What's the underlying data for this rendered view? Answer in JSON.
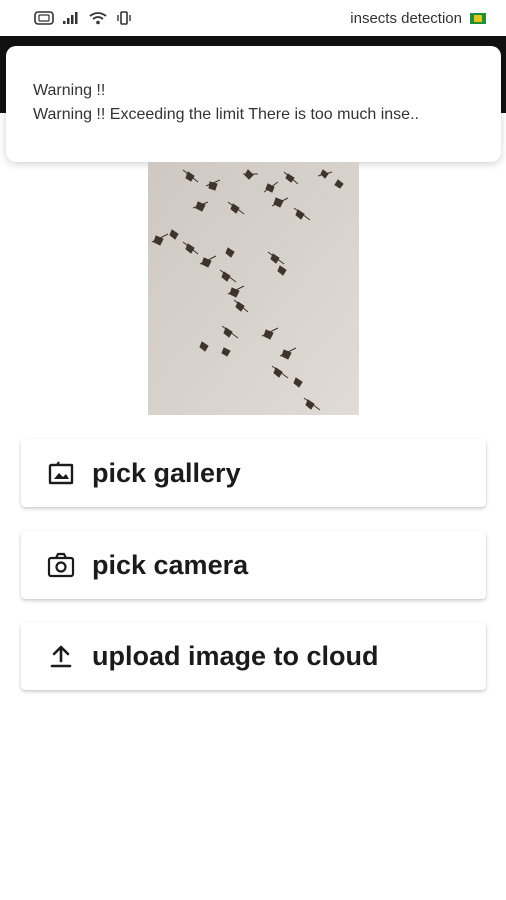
{
  "status_bar": {
    "app_name": "insects detection",
    "icons": [
      "sim-icon",
      "signal-icon",
      "wifi-icon",
      "vibrate-icon",
      "flag-icon"
    ]
  },
  "notification": {
    "title": "Warning !!",
    "body": "Warning !! Exceeding the limit There is too much inse.."
  },
  "image": {
    "description_icon": "insects-photo"
  },
  "buttons": {
    "gallery": {
      "label": "pick gallery",
      "icon": "gallery-icon"
    },
    "camera": {
      "label": "pick camera",
      "icon": "camera-icon"
    },
    "upload": {
      "label": "upload image to cloud",
      "icon": "upload-icon"
    }
  },
  "colors": {
    "app_bar": "#111111",
    "background": "#ffffff",
    "button_text": "#1b1b1b"
  }
}
